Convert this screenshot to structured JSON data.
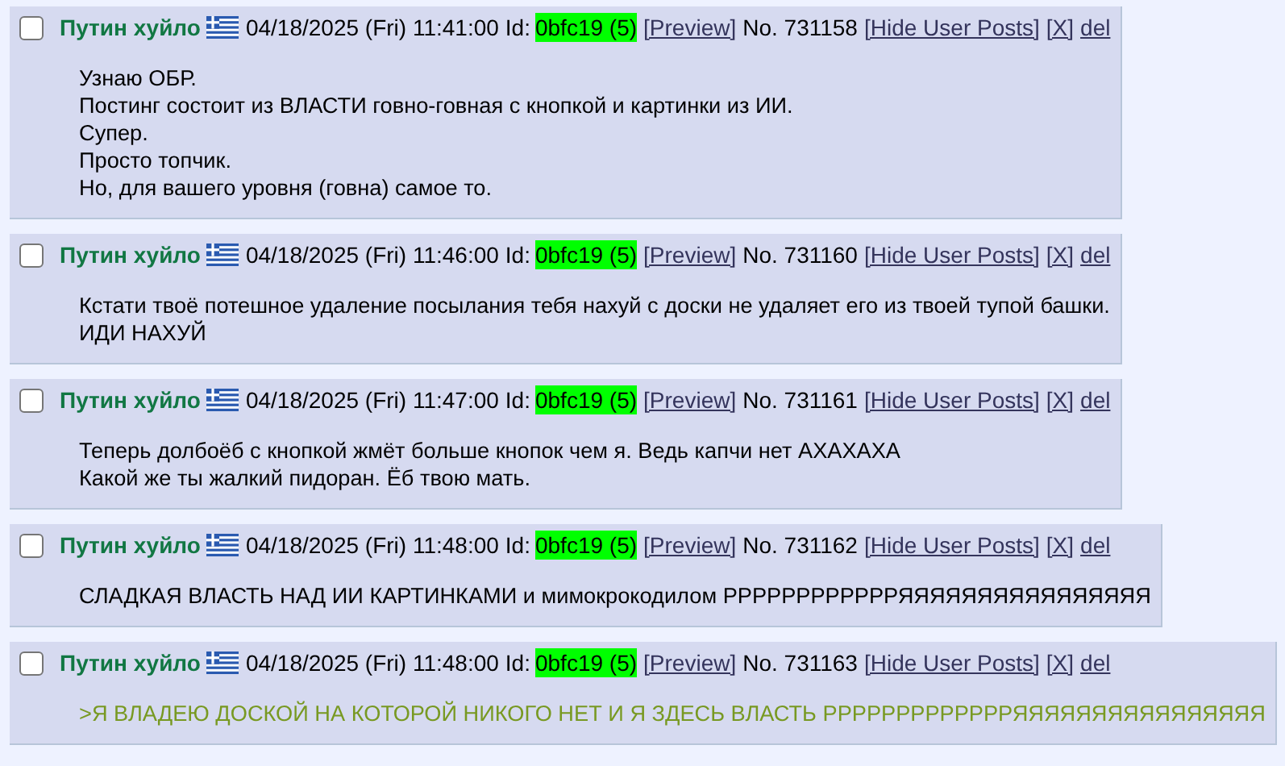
{
  "posts": [
    {
      "checked": false,
      "name": "Путин хуйло",
      "datetime": "04/18/2025 (Fri) 11:41:00",
      "id_label": "Id:",
      "id": "0bfc19 (5)",
      "preview": "[Preview]",
      "number": "No. 731158",
      "hide": "[Hide User Posts]",
      "x": "[X]",
      "del": "del",
      "lines": [
        {
          "kind": "text",
          "text": "Узнаю ОБР."
        },
        {
          "kind": "text",
          "text": "Постинг состоит из ВЛАСТИ говно-говная с кнопкой и картинки из ИИ."
        },
        {
          "kind": "text",
          "text": "Супер."
        },
        {
          "kind": "text",
          "text": "Просто топчик."
        },
        {
          "kind": "text",
          "text": "Но, для вашего уровня (говна) самое то."
        }
      ]
    },
    {
      "checked": false,
      "name": "Путин хуйло",
      "datetime": "04/18/2025 (Fri) 11:46:00",
      "id_label": "Id:",
      "id": "0bfc19 (5)",
      "preview": "[Preview]",
      "number": "No. 731160",
      "hide": "[Hide User Posts]",
      "x": "[X]",
      "del": "del",
      "lines": [
        {
          "kind": "text",
          "text": "Кстати твоё потешное удаление посылания тебя нахуй с доски не удаляет его из твоей тупой башки."
        },
        {
          "kind": "text",
          "text": "ИДИ НАХУЙ"
        }
      ]
    },
    {
      "checked": false,
      "name": "Путин хуйло",
      "datetime": "04/18/2025 (Fri) 11:47:00",
      "id_label": "Id:",
      "id": "0bfc19 (5)",
      "preview": "[Preview]",
      "number": "No. 731161",
      "hide": "[Hide User Posts]",
      "x": "[X]",
      "del": "del",
      "lines": [
        {
          "kind": "text",
          "text": "Теперь долбоёб с кнопкой жмёт больше кнопок чем я. Ведь капчи нет АХАХАХА"
        },
        {
          "kind": "text",
          "text": "Какой же ты жалкий пидоран. Ёб твою мать."
        }
      ]
    },
    {
      "checked": false,
      "name": "Путин хуйло",
      "datetime": "04/18/2025 (Fri) 11:48:00",
      "id_label": "Id:",
      "id": "0bfc19 (5)",
      "preview": "[Preview]",
      "number": "No. 731162",
      "hide": "[Hide User Posts]",
      "x": "[X]",
      "del": "del",
      "lines": [
        {
          "kind": "text",
          "text": "СЛАДКАЯ ВЛАСТЬ НАД ИИ КАРТИНКАМИ и мимокрокодилом РРРРРРРРРРРРЯЯЯЯЯЯЯЯЯЯЯЯЯЯЯЯ"
        }
      ]
    },
    {
      "checked": false,
      "name": "Путин хуйло",
      "datetime": "04/18/2025 (Fri) 11:48:00",
      "id_label": "Id:",
      "id": "0bfc19 (5)",
      "preview": "[Preview]",
      "number": "No. 731163",
      "hide": "[Hide User Posts]",
      "x": "[X]",
      "del": "del",
      "lines": [
        {
          "kind": "quote",
          "text": ">Я ВЛАДЕЮ ДОСКОЙ НА КОТОРОЙ НИКОГО НЕТ И Я ЗДЕСЬ ВЛАСТЬ РРРРРРРРРРРРРЯЯЯЯЯЯЯЯЯЯЯЯЯЯЯЯ"
        }
      ]
    }
  ]
}
